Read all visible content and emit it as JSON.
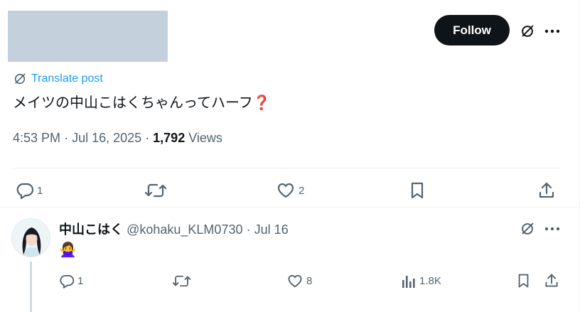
{
  "header": {
    "follow_label": "Follow",
    "grok_icon": "grok-slash-icon",
    "more_icon": "more-icon"
  },
  "post": {
    "translate_label": "Translate post",
    "text": "メイツの中山こはくちゃんってハーフ",
    "question_mark": "❓",
    "time": "4:53 PM",
    "date": "Jul 16, 2025",
    "views_count": "1,792",
    "views_label": "Views",
    "actions": {
      "replies": "1",
      "reposts": "",
      "likes": "2"
    }
  },
  "reply": {
    "display_name": "中山こはく",
    "handle": "@kohaku_KLM0730",
    "date": "Jul 16",
    "text": "🙅‍♀️",
    "actions": {
      "replies": "1",
      "reposts": "",
      "likes": "8",
      "views": "1.8K"
    }
  },
  "colors": {
    "accent": "#1d9bf0",
    "text": "#0f1419",
    "muted": "#536471",
    "placeholder": "#c4d1dd"
  }
}
